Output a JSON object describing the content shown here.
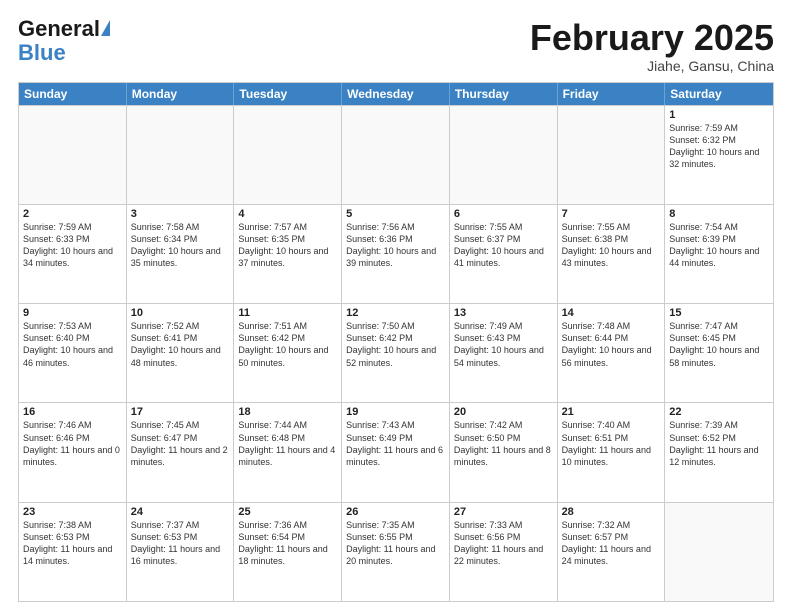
{
  "header": {
    "logo_general": "General",
    "logo_blue": "Blue",
    "title": "February 2025",
    "subtitle": "Jiahe, Gansu, China"
  },
  "weekdays": [
    "Sunday",
    "Monday",
    "Tuesday",
    "Wednesday",
    "Thursday",
    "Friday",
    "Saturday"
  ],
  "weeks": [
    [
      {
        "day": "",
        "info": ""
      },
      {
        "day": "",
        "info": ""
      },
      {
        "day": "",
        "info": ""
      },
      {
        "day": "",
        "info": ""
      },
      {
        "day": "",
        "info": ""
      },
      {
        "day": "",
        "info": ""
      },
      {
        "day": "1",
        "info": "Sunrise: 7:59 AM\nSunset: 6:32 PM\nDaylight: 10 hours and 32 minutes."
      }
    ],
    [
      {
        "day": "2",
        "info": "Sunrise: 7:59 AM\nSunset: 6:33 PM\nDaylight: 10 hours and 34 minutes."
      },
      {
        "day": "3",
        "info": "Sunrise: 7:58 AM\nSunset: 6:34 PM\nDaylight: 10 hours and 35 minutes."
      },
      {
        "day": "4",
        "info": "Sunrise: 7:57 AM\nSunset: 6:35 PM\nDaylight: 10 hours and 37 minutes."
      },
      {
        "day": "5",
        "info": "Sunrise: 7:56 AM\nSunset: 6:36 PM\nDaylight: 10 hours and 39 minutes."
      },
      {
        "day": "6",
        "info": "Sunrise: 7:55 AM\nSunset: 6:37 PM\nDaylight: 10 hours and 41 minutes."
      },
      {
        "day": "7",
        "info": "Sunrise: 7:55 AM\nSunset: 6:38 PM\nDaylight: 10 hours and 43 minutes."
      },
      {
        "day": "8",
        "info": "Sunrise: 7:54 AM\nSunset: 6:39 PM\nDaylight: 10 hours and 44 minutes."
      }
    ],
    [
      {
        "day": "9",
        "info": "Sunrise: 7:53 AM\nSunset: 6:40 PM\nDaylight: 10 hours and 46 minutes."
      },
      {
        "day": "10",
        "info": "Sunrise: 7:52 AM\nSunset: 6:41 PM\nDaylight: 10 hours and 48 minutes."
      },
      {
        "day": "11",
        "info": "Sunrise: 7:51 AM\nSunset: 6:42 PM\nDaylight: 10 hours and 50 minutes."
      },
      {
        "day": "12",
        "info": "Sunrise: 7:50 AM\nSunset: 6:42 PM\nDaylight: 10 hours and 52 minutes."
      },
      {
        "day": "13",
        "info": "Sunrise: 7:49 AM\nSunset: 6:43 PM\nDaylight: 10 hours and 54 minutes."
      },
      {
        "day": "14",
        "info": "Sunrise: 7:48 AM\nSunset: 6:44 PM\nDaylight: 10 hours and 56 minutes."
      },
      {
        "day": "15",
        "info": "Sunrise: 7:47 AM\nSunset: 6:45 PM\nDaylight: 10 hours and 58 minutes."
      }
    ],
    [
      {
        "day": "16",
        "info": "Sunrise: 7:46 AM\nSunset: 6:46 PM\nDaylight: 11 hours and 0 minutes."
      },
      {
        "day": "17",
        "info": "Sunrise: 7:45 AM\nSunset: 6:47 PM\nDaylight: 11 hours and 2 minutes."
      },
      {
        "day": "18",
        "info": "Sunrise: 7:44 AM\nSunset: 6:48 PM\nDaylight: 11 hours and 4 minutes."
      },
      {
        "day": "19",
        "info": "Sunrise: 7:43 AM\nSunset: 6:49 PM\nDaylight: 11 hours and 6 minutes."
      },
      {
        "day": "20",
        "info": "Sunrise: 7:42 AM\nSunset: 6:50 PM\nDaylight: 11 hours and 8 minutes."
      },
      {
        "day": "21",
        "info": "Sunrise: 7:40 AM\nSunset: 6:51 PM\nDaylight: 11 hours and 10 minutes."
      },
      {
        "day": "22",
        "info": "Sunrise: 7:39 AM\nSunset: 6:52 PM\nDaylight: 11 hours and 12 minutes."
      }
    ],
    [
      {
        "day": "23",
        "info": "Sunrise: 7:38 AM\nSunset: 6:53 PM\nDaylight: 11 hours and 14 minutes."
      },
      {
        "day": "24",
        "info": "Sunrise: 7:37 AM\nSunset: 6:53 PM\nDaylight: 11 hours and 16 minutes."
      },
      {
        "day": "25",
        "info": "Sunrise: 7:36 AM\nSunset: 6:54 PM\nDaylight: 11 hours and 18 minutes."
      },
      {
        "day": "26",
        "info": "Sunrise: 7:35 AM\nSunset: 6:55 PM\nDaylight: 11 hours and 20 minutes."
      },
      {
        "day": "27",
        "info": "Sunrise: 7:33 AM\nSunset: 6:56 PM\nDaylight: 11 hours and 22 minutes."
      },
      {
        "day": "28",
        "info": "Sunrise: 7:32 AM\nSunset: 6:57 PM\nDaylight: 11 hours and 24 minutes."
      },
      {
        "day": "",
        "info": ""
      }
    ]
  ]
}
